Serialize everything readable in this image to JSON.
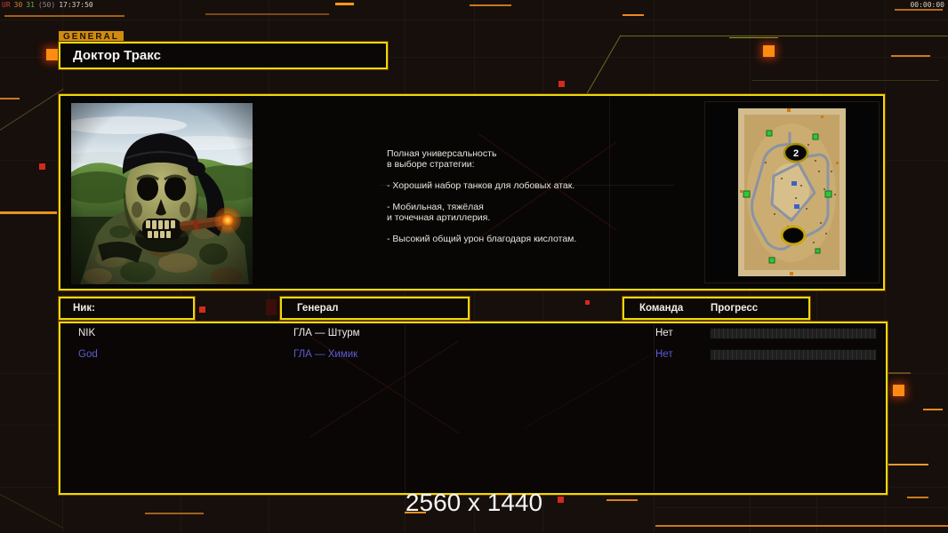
{
  "hud": {
    "debug": {
      "seg1": {
        "text": "UR",
        "color": "#c84034"
      },
      "seg2": {
        "text": "30",
        "color": "#c88834"
      },
      "seg3": {
        "text": "31",
        "color": "#60b44c"
      },
      "seg4": {
        "text": "(50)",
        "color": "#8a8a92"
      },
      "seg5": {
        "text": "17:37:50",
        "color": "#d6d2cc"
      }
    },
    "match_timer": "00:00:00"
  },
  "header": {
    "tab_label": "GENERAL",
    "general_name": "Доктор Тракс"
  },
  "briefing": {
    "description": "Полная универсальность\nв выборе стратегии:\n\n- Хороший набор танков для лобовых атак.\n\n- Мобильная, тяжёлая\nи точечная артиллерия.\n\n- Высокий общий урон благодаря кислотам.",
    "minimap": {
      "start_marker_top": "2"
    }
  },
  "players": {
    "headers": {
      "nick": "Ник:",
      "general": "Генерал",
      "team": "Команда",
      "progress": "Прогресс"
    },
    "rows": [
      {
        "nick": "NIK",
        "general": "ГЛА — Штурм",
        "team": "Нет",
        "progress_percent": 0,
        "color": "#ecece8"
      },
      {
        "nick": "God",
        "general": "ГЛА — Химик",
        "team": "Нет",
        "progress_percent": 0,
        "color": "#5c5cd6"
      }
    ]
  },
  "watermark": "2560 x 1440",
  "colors": {
    "panel_border": "#e8dc08",
    "accent_orange": "#ff8c12",
    "tab_bg": "#cf8c10",
    "enemy_row_blue": "#5c5cd6"
  }
}
